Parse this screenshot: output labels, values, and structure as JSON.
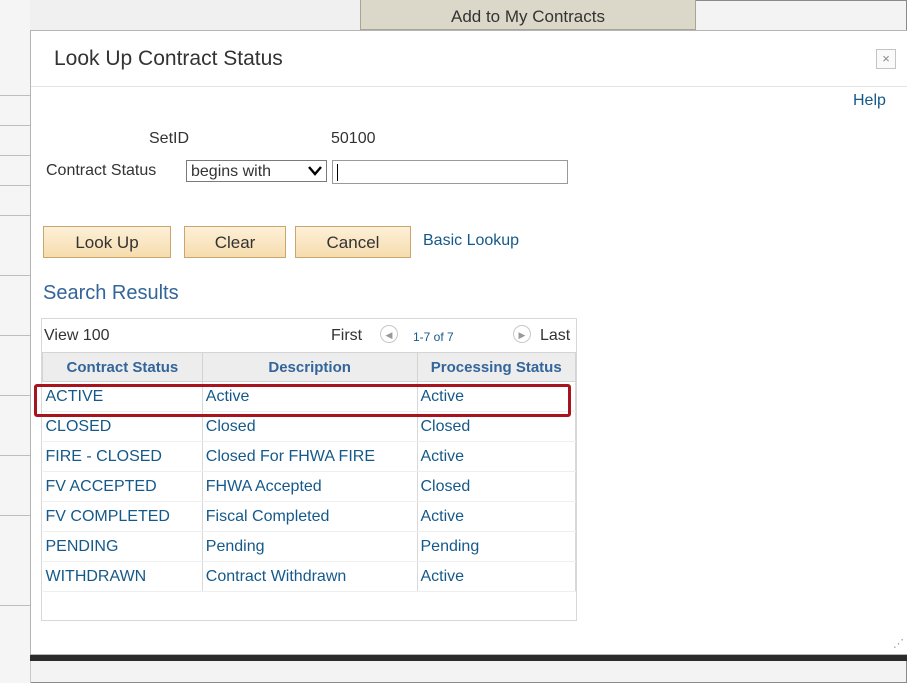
{
  "background": {
    "top_button_label": "Add to My Contracts"
  },
  "dialog": {
    "title": "Look Up Contract Status",
    "close_icon": "close-icon",
    "close_glyph": "×",
    "help_label": "Help"
  },
  "search_criteria": {
    "setid_label": "SetID",
    "setid_value": "50100",
    "contract_status_label": "Contract Status",
    "operator_selected": "begins with",
    "contract_status_value": ""
  },
  "buttons": {
    "lookup": "Look Up",
    "clear": "Clear",
    "cancel": "Cancel",
    "basic_lookup": "Basic Lookup"
  },
  "results": {
    "title": "Search Results",
    "view_label": "View 100",
    "first_label": "First",
    "range_label": "1-7 of 7",
    "last_label": "Last",
    "columns": [
      "Contract Status",
      "Description",
      "Processing Status"
    ],
    "rows": [
      [
        "ACTIVE",
        "Active",
        "Active"
      ],
      [
        "CLOSED",
        "Closed",
        "Closed"
      ],
      [
        "FIRE - CLOSED",
        "Closed For FHWA FIRE",
        "Active"
      ],
      [
        "FV ACCEPTED",
        "FHWA Accepted",
        "Closed"
      ],
      [
        "FV COMPLETED",
        "Fiscal Completed",
        "Active"
      ],
      [
        "PENDING",
        "Pending",
        "Pending"
      ],
      [
        "WITHDRAWN",
        "Contract Withdrawn",
        "Active"
      ]
    ],
    "highlighted_row": "ACTIVE"
  },
  "colors": {
    "link": "#15598a",
    "header_text": "#33659a",
    "highlight_border": "#a8141e",
    "button_fill": "#f6dcae"
  }
}
